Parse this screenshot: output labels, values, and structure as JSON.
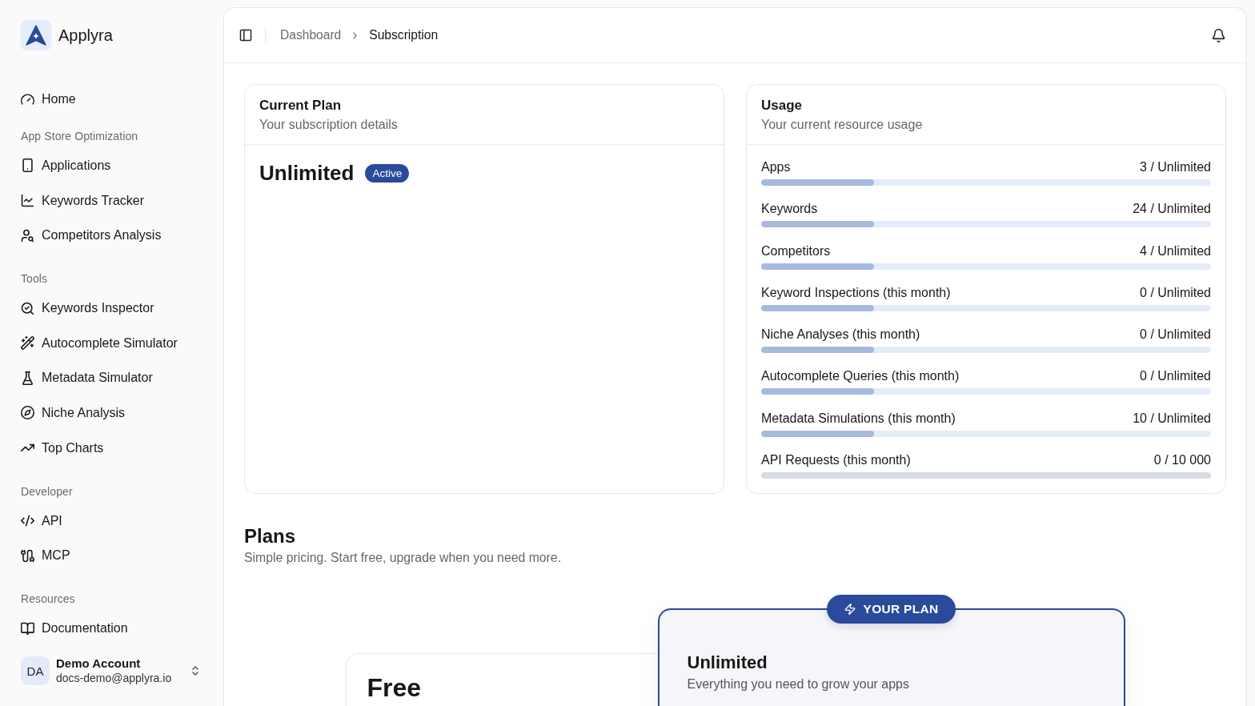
{
  "sidebar": {
    "brand": "Applyra",
    "sections": [
      {
        "items": [
          {
            "label": "Home",
            "selected": false
          }
        ]
      },
      {
        "title": "App Store Optimization",
        "items": [
          {
            "label": "Applications",
            "selected": false
          },
          {
            "label": "Keywords Tracker",
            "selected": false
          },
          {
            "label": "Competitors Analysis",
            "selected": false
          }
        ]
      },
      {
        "title": "Tools",
        "items": [
          {
            "label": "Keywords Inspector",
            "selected": false
          },
          {
            "label": "Autocomplete Simulator",
            "selected": false
          },
          {
            "label": "Metadata Simulator",
            "selected": false
          },
          {
            "label": "Niche Analysis",
            "selected": false
          },
          {
            "label": "Top Charts",
            "selected": false
          }
        ]
      },
      {
        "title": "Developer",
        "items": [
          {
            "label": "API",
            "selected": false
          },
          {
            "label": "MCP",
            "selected": false
          }
        ]
      },
      {
        "title": "Resources",
        "items": [
          {
            "label": "Documentation",
            "selected": false
          }
        ]
      }
    ],
    "account": {
      "initials": "DA",
      "name": "Demo Account",
      "email": "docs-demo@applyra.io"
    }
  },
  "header": {
    "breadcrumb": [
      {
        "label": "Dashboard",
        "current": false
      },
      {
        "label": "Subscription",
        "current": true
      }
    ]
  },
  "current_plan": {
    "title": "Current Plan",
    "subtitle": "Your subscription details",
    "plan_name": "Unlimited",
    "status": "Active"
  },
  "usage": {
    "title": "Usage",
    "subtitle": "Your current resource usage",
    "rows": [
      {
        "label": "Apps",
        "reading": "3 / Unlimited",
        "kind": "unlimited",
        "level": 0.25
      },
      {
        "label": "Keywords",
        "reading": "24 / Unlimited",
        "kind": "unlimited",
        "level": 0.25
      },
      {
        "label": "Competitors",
        "reading": "4 / Unlimited",
        "kind": "unlimited",
        "level": 0.25
      },
      {
        "label": "Keyword Inspections (this month)",
        "reading": "0 / Unlimited",
        "kind": "unlimited",
        "level": 0.25
      },
      {
        "label": "Niche Analyses (this month)",
        "reading": "0 / Unlimited",
        "kind": "unlimited",
        "level": 0.25
      },
      {
        "label": "Autocomplete Queries (this month)",
        "reading": "0 / Unlimited",
        "kind": "unlimited",
        "level": 0.25
      },
      {
        "label": "Metadata Simulations (this month)",
        "reading": "10 / Unlimited",
        "kind": "unlimited",
        "level": 0.25
      },
      {
        "label": "API Requests (this month)",
        "reading": "0 / 10 000",
        "kind": "metered"
      }
    ]
  },
  "plans": {
    "title": "Plans",
    "subtitle": "Simple pricing. Start free, upgrade when you need more.",
    "cards": [
      {
        "name": "Free",
        "current": false
      },
      {
        "name": "Unlimited",
        "description": "Everything you need to grow your apps",
        "current": true,
        "badge": "YOUR PLAN"
      }
    ]
  }
}
